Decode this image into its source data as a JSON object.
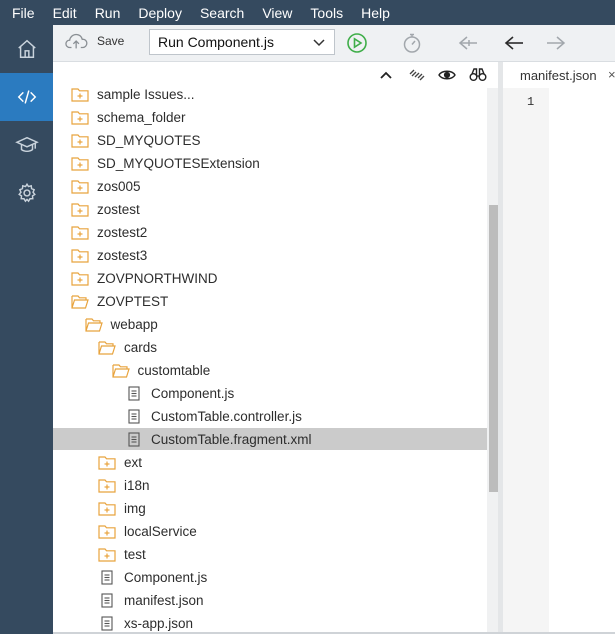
{
  "menubar": {
    "items": [
      "File",
      "Edit",
      "Run",
      "Deploy",
      "Search",
      "View",
      "Tools",
      "Help"
    ]
  },
  "rail": {
    "items": [
      {
        "icon": "home-icon",
        "active": false
      },
      {
        "icon": "code-icon",
        "active": true
      },
      {
        "icon": "graduation-cap-icon",
        "active": false
      },
      {
        "icon": "gear-icon",
        "active": false
      }
    ]
  },
  "toolbar": {
    "save_label": "Save",
    "run_config": "Run Component.js"
  },
  "tree": {
    "rows": [
      {
        "label": "sample Issues...",
        "type": "folder-closed",
        "depth": 0,
        "partial": true
      },
      {
        "label": "schema_folder",
        "type": "folder-closed",
        "depth": 0
      },
      {
        "label": "SD_MYQUOTES",
        "type": "folder-closed",
        "depth": 0
      },
      {
        "label": "SD_MYQUOTESExtension",
        "type": "folder-closed",
        "depth": 0
      },
      {
        "label": "zos005",
        "type": "folder-closed",
        "depth": 0
      },
      {
        "label": "zostest",
        "type": "folder-closed",
        "depth": 0
      },
      {
        "label": "zostest2",
        "type": "folder-closed",
        "depth": 0
      },
      {
        "label": "zostest3",
        "type": "folder-closed",
        "depth": 0
      },
      {
        "label": "ZOVPNORTHWIND",
        "type": "folder-closed",
        "depth": 0
      },
      {
        "label": "ZOVPTEST",
        "type": "folder-open",
        "depth": 0
      },
      {
        "label": "webapp",
        "type": "folder-open",
        "depth": 1
      },
      {
        "label": "cards",
        "type": "folder-open",
        "depth": 2
      },
      {
        "label": "customtable",
        "type": "folder-open",
        "depth": 3
      },
      {
        "label": "Component.js",
        "type": "file",
        "depth": 4
      },
      {
        "label": "CustomTable.controller.js",
        "type": "file",
        "depth": 4
      },
      {
        "label": "CustomTable.fragment.xml",
        "type": "file",
        "depth": 4,
        "selected": true
      },
      {
        "label": "ext",
        "type": "folder-closed",
        "depth": 2
      },
      {
        "label": "i18n",
        "type": "folder-closed",
        "depth": 2
      },
      {
        "label": "img",
        "type": "folder-closed",
        "depth": 2
      },
      {
        "label": "localService",
        "type": "folder-closed",
        "depth": 2
      },
      {
        "label": "test",
        "type": "folder-closed",
        "depth": 2
      },
      {
        "label": "Component.js",
        "type": "file",
        "depth": 2
      },
      {
        "label": "manifest.json",
        "type": "file",
        "depth": 2
      },
      {
        "label": "xs-app.json",
        "type": "file",
        "depth": 2
      }
    ]
  },
  "editor": {
    "tab_label": "manifest.json",
    "tab_close": "×",
    "line_number": "1"
  },
  "colors": {
    "shell": "#354a5f",
    "active_rail": "#2b7bc0",
    "folder": "#e8a33d",
    "run_green": "#3fae49",
    "selected_row": "#cbcbcb"
  }
}
